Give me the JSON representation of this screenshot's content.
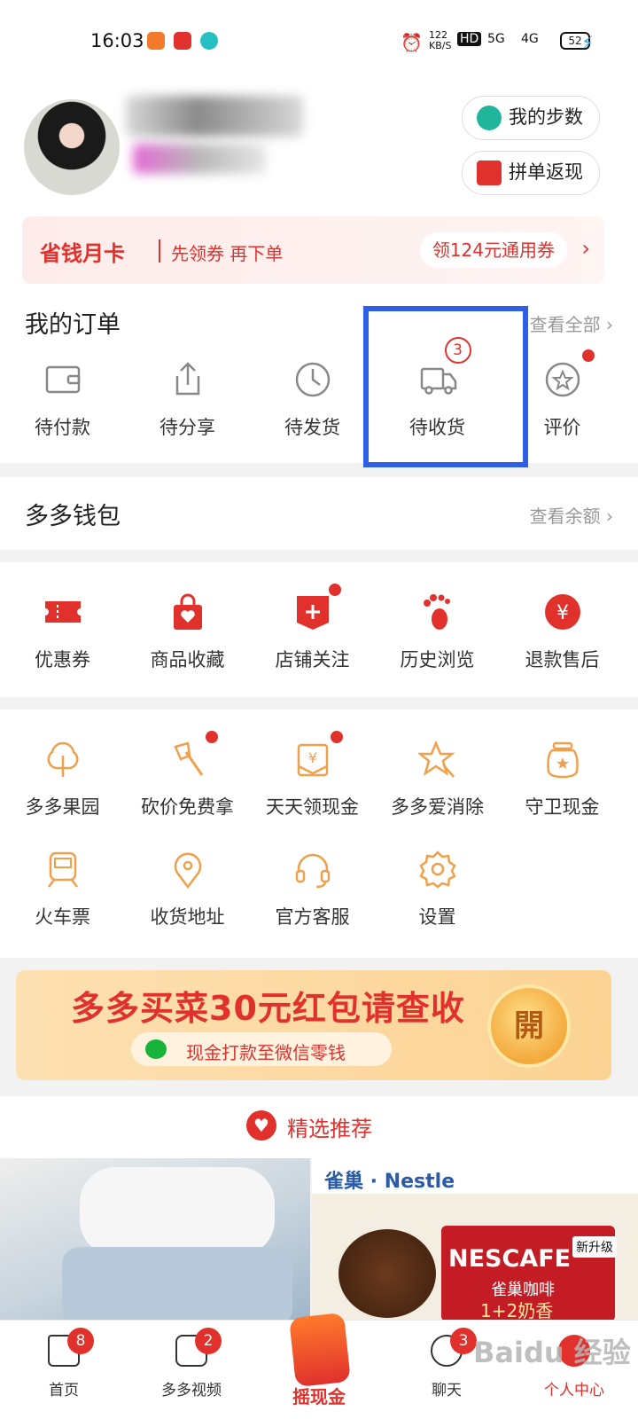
{
  "status_bar": {
    "time": "16:03",
    "net_speed": "122 KB/S",
    "hd": "HD",
    "signal_1": "5G",
    "signal_2": "4G",
    "battery": "52"
  },
  "profile": {
    "steps_label": "我的步数",
    "group_cashback_label": "拼单返现"
  },
  "monthly_card": {
    "title": "省钱月卡",
    "subtitle": "先领券 再下单",
    "coupon": "领124元通用券",
    "arrow": "›"
  },
  "orders": {
    "title": "我的订单",
    "view_all": "查看全部 ›",
    "items": [
      {
        "label": "待付款",
        "icon": "wallet-icon"
      },
      {
        "label": "待分享",
        "icon": "share-icon"
      },
      {
        "label": "待发货",
        "icon": "clock-icon"
      },
      {
        "label": "待收货",
        "icon": "truck-icon",
        "badge": "3"
      },
      {
        "label": "评价",
        "icon": "review-icon",
        "dot": true
      }
    ]
  },
  "wallet": {
    "title": "多多钱包",
    "link": "查看余额 ›"
  },
  "assets": {
    "items": [
      {
        "label": "优惠券",
        "icon": "coupon-icon"
      },
      {
        "label": "商品收藏",
        "icon": "bag-icon"
      },
      {
        "label": "店铺关注",
        "icon": "store-follow-icon",
        "dot": true
      },
      {
        "label": "历史浏览",
        "icon": "footprint-icon"
      },
      {
        "label": "退款售后",
        "icon": "refund-icon"
      }
    ]
  },
  "services": {
    "items": [
      {
        "label": "多多果园",
        "icon": "tree-icon"
      },
      {
        "label": "砍价免费拿",
        "icon": "axe-icon",
        "dot": true
      },
      {
        "label": "天天领现金",
        "icon": "cash-envelope-icon",
        "dot": true
      },
      {
        "label": "多多爱消除",
        "icon": "star-icon"
      },
      {
        "label": "守卫现金",
        "icon": "jar-icon"
      },
      {
        "label": "火车票",
        "icon": "train-icon"
      },
      {
        "label": "收货地址",
        "icon": "location-icon"
      },
      {
        "label": "官方客服",
        "icon": "headset-icon"
      },
      {
        "label": "设置",
        "icon": "gear-icon"
      }
    ]
  },
  "promo": {
    "title": "多多买菜30元红包请查收",
    "subtitle": "现金打款至微信零钱",
    "open": "開"
  },
  "recommend": {
    "label": "精选推荐"
  },
  "products": {
    "right": {
      "brand_cn": "雀巢",
      "brand_en": "Nestle",
      "product": "NESCAFE",
      "product_cn": "雀巢咖啡",
      "flavor": "1+2奶香",
      "tag": "新升级"
    }
  },
  "tabbar": {
    "items": [
      {
        "label": "首页",
        "badge": "8",
        "icon": "home-icon"
      },
      {
        "label": "多多视频",
        "badge": "2",
        "icon": "video-icon"
      },
      {
        "label": "摇现金",
        "icon": "shake-cash-icon"
      },
      {
        "label": "聊天",
        "badge": "3",
        "icon": "chat-icon"
      },
      {
        "label": "个人中心",
        "icon": "profile-icon"
      }
    ]
  },
  "watermark": "Baidu 经验",
  "colors": {
    "accent": "#e0312d",
    "highlight_box": "#2f5fe7",
    "service_icon": "#f0a04b"
  }
}
